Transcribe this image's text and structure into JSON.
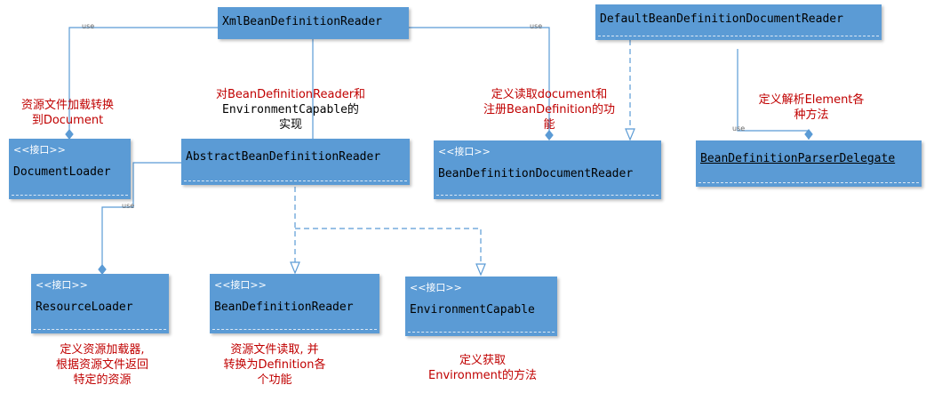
{
  "classes": {
    "xml_reader": {
      "name": "XmlBeanDefinitionReader"
    },
    "default_doc_reader": {
      "name": "DefaultBeanDefinitionDocumentReader"
    },
    "document_loader": {
      "stereotype": "<<接口>>",
      "name": "DocumentLoader"
    },
    "abstract_reader": {
      "name": "AbstractBeanDefinitionReader"
    },
    "doc_reader_iface": {
      "stereotype": "<<接口>>",
      "name": "BeanDefinitionDocumentReader"
    },
    "parser_delegate": {
      "name": "BeanDefinitionParserDelegate"
    },
    "resource_loader": {
      "stereotype": "<<接口>>",
      "name": "ResourceLoader"
    },
    "reader_iface": {
      "stereotype": "<<接口>>",
      "name": "BeanDefinitionReader"
    },
    "env_capable": {
      "stereotype": "<<接口>>",
      "name": "EnvironmentCapable"
    }
  },
  "notes": {
    "document_loader": [
      "资源文件加载转换",
      "到Document"
    ],
    "abstract_reader": [
      "对BeanDefinitionReader和",
      "EnvironmentCapable的",
      "实现"
    ],
    "doc_reader": [
      "定义读取document和",
      "注册BeanDefinition的功",
      "能"
    ],
    "parser_delegate": [
      "定义解析Element各",
      "种方法"
    ],
    "resource_loader": [
      "定义资源加载器,",
      "根据资源文件返回",
      "特定的资源"
    ],
    "reader_iface": [
      "资源文件读取, 并",
      "转换为Definition各",
      "个功能"
    ],
    "env_capable": [
      "定义获取",
      "Environment的方法"
    ]
  },
  "connectors": {
    "use_label": "use"
  },
  "colors": {
    "box_fill": "#5b9bd5",
    "line": "#5b9bd5",
    "note_text": "#c00000"
  }
}
